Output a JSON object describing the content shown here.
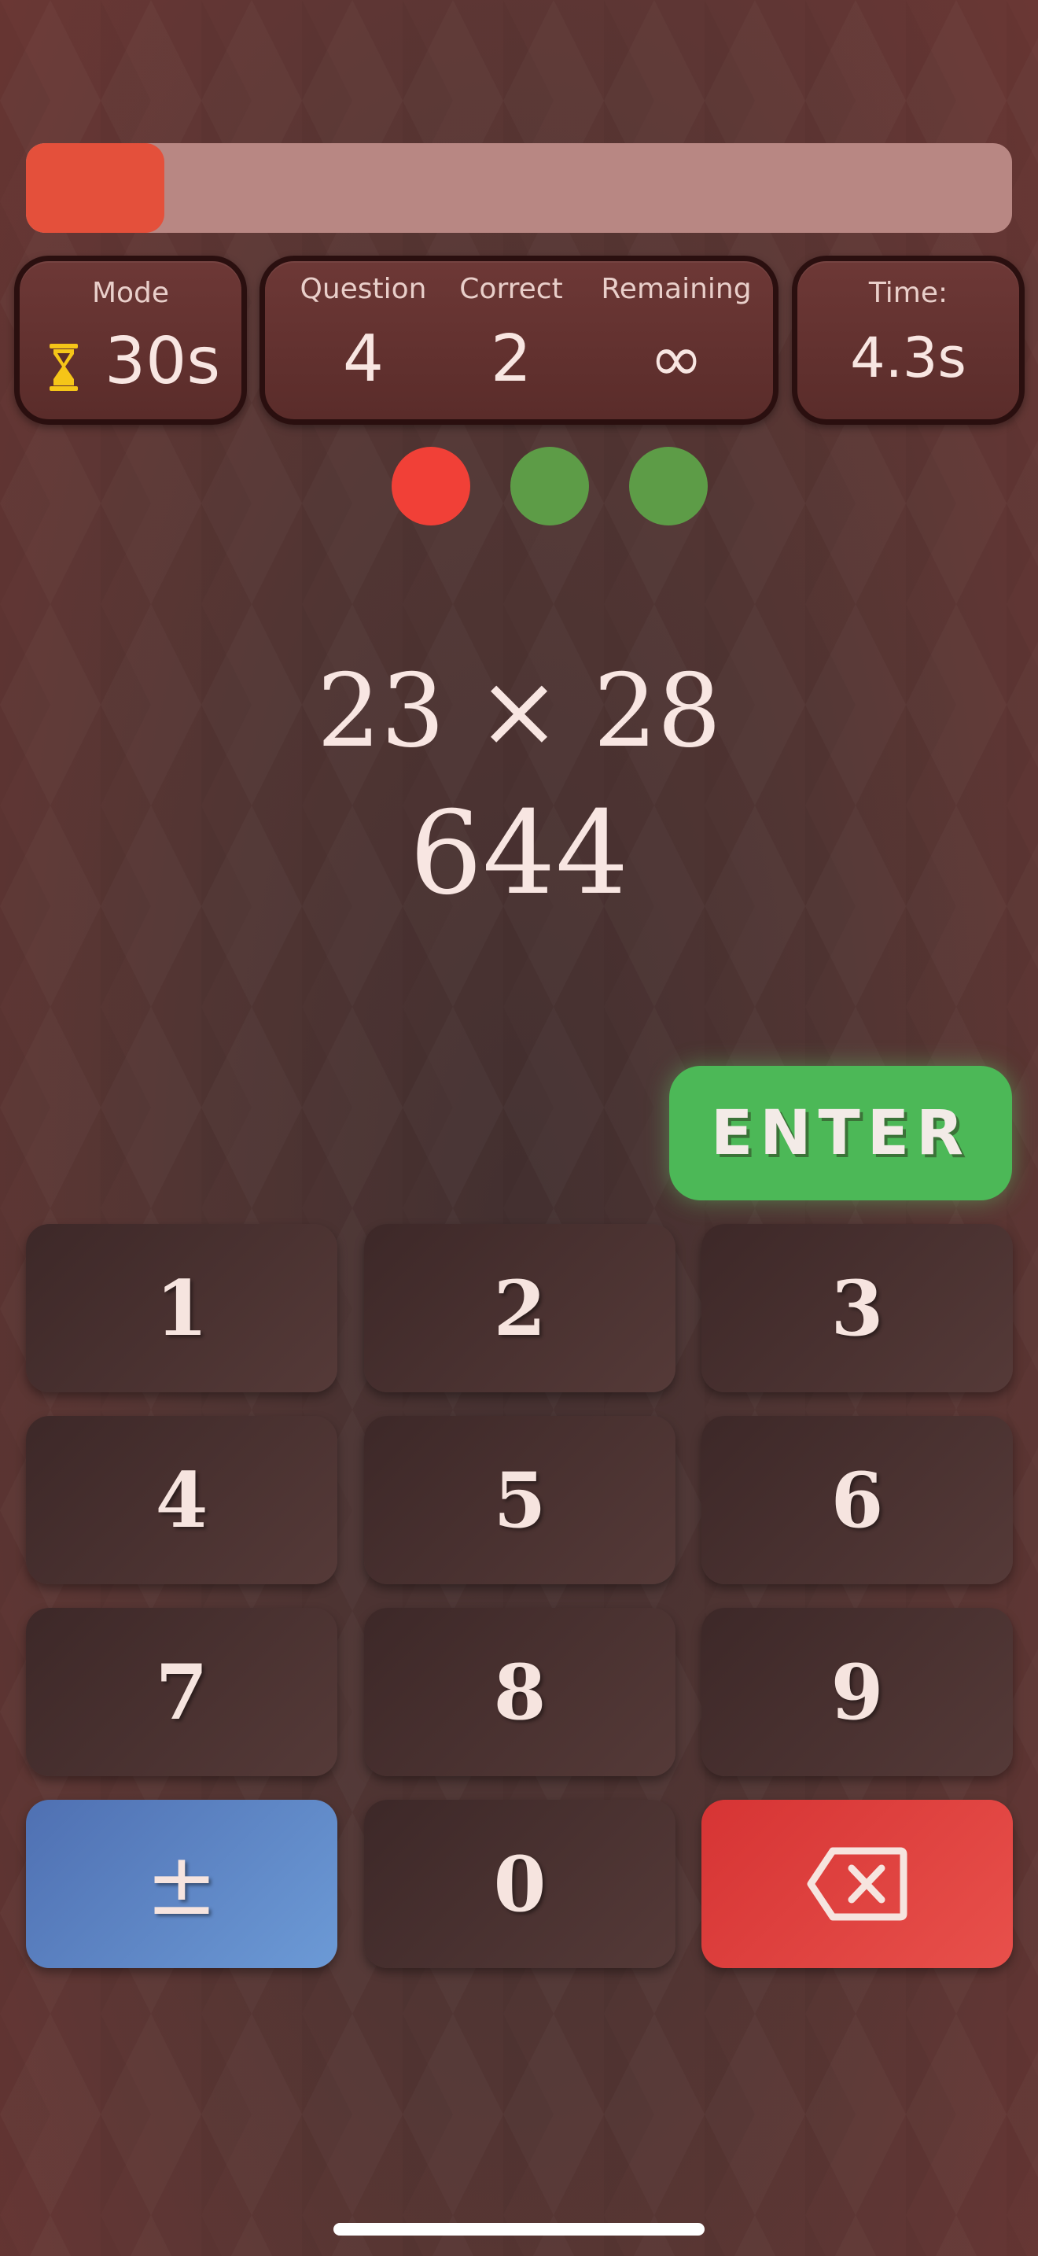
{
  "progress": {
    "fraction": 0.14,
    "color": "#e4503b"
  },
  "mode": {
    "label": "Mode",
    "value": "30s",
    "icon": "hourglass-icon",
    "icon_color": "#f5c518"
  },
  "stats": [
    {
      "label": "Question",
      "value": "4"
    },
    {
      "label": "Correct",
      "value": "2"
    },
    {
      "label": "Remaining",
      "value": "∞"
    }
  ],
  "time": {
    "label": "Time:",
    "value": "4.3s"
  },
  "results": [
    {
      "status": "wrong",
      "color": "#f14037"
    },
    {
      "status": "correct",
      "color": "#5d9c47"
    },
    {
      "status": "correct",
      "color": "#5d9c47"
    }
  ],
  "problem": {
    "expression": "23 × 28",
    "answer": "644"
  },
  "enter_label": "ENTER",
  "keys": {
    "k1": "1",
    "k2": "2",
    "k3": "3",
    "k4": "4",
    "k5": "5",
    "k6": "6",
    "k7": "7",
    "k8": "8",
    "k9": "9",
    "sign": "±",
    "k0": "0",
    "delete_icon": "backspace-icon"
  }
}
